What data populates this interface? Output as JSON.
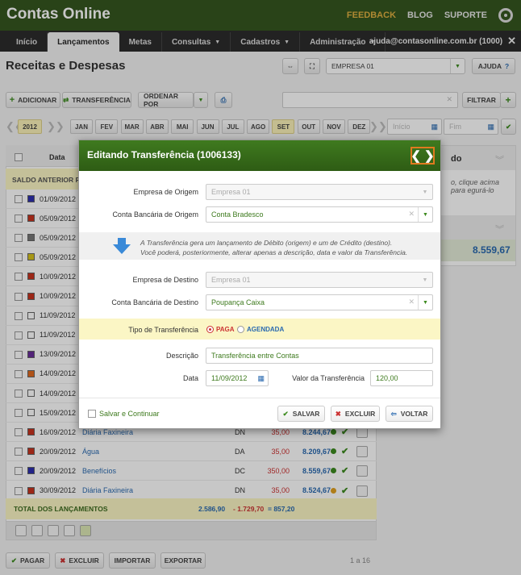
{
  "app": {
    "title": "Contas Online",
    "links": {
      "feedback": "FEEDBACK",
      "blog": "BLOG",
      "suporte": "SUPORTE"
    }
  },
  "nav": {
    "tabs": [
      "Início",
      "Lançamentos",
      "Metas",
      "Consultas",
      "Cadastros",
      "Administração"
    ],
    "user": "ajuda@contasonline.com.br (1000)"
  },
  "page": {
    "title": "Receitas e Despesas",
    "empresa": "EMPRESA 01",
    "ajuda": "AJUDA"
  },
  "toolbar": {
    "adicionar": "ADICIONAR",
    "transferencia": "TRANSFERÊNCIA",
    "ordenar": "ORDENAR POR",
    "filtrar": "FILTRAR"
  },
  "months": {
    "year": "2012",
    "list": [
      "JAN",
      "FEV",
      "MAR",
      "ABR",
      "MAI",
      "JUN",
      "JUL",
      "AGO",
      "SET",
      "OUT",
      "NOV",
      "DEZ"
    ],
    "active": "SET",
    "inicio": "Início",
    "fim": "Fim"
  },
  "table": {
    "col_data": "Data",
    "saldo_anterior": "SALDO ANTERIOR REA",
    "total_label": "TOTAL DOS LANÇAMENTOS",
    "total_in": "2.586,90",
    "total_out": "- 1.729,70",
    "total_eq": "= 857,20",
    "rows": [
      {
        "date": "01/09/2012",
        "color": "#2d2fb0"
      },
      {
        "date": "05/09/2012",
        "color": "#c8321e"
      },
      {
        "date": "05/09/2012",
        "color": "#777777"
      },
      {
        "date": "05/09/2012",
        "color": "#d7c21c"
      },
      {
        "date": "10/09/2012",
        "color": "#c8321e"
      },
      {
        "date": "10/09/2012",
        "color": "#c8321e"
      },
      {
        "date": "11/09/2012",
        "color": "#ffffff"
      },
      {
        "date": "11/09/2012",
        "color": "#ffffff"
      },
      {
        "date": "13/09/2012",
        "color": "#6a2d9a"
      },
      {
        "date": "14/09/2012",
        "color": "#e06a1f"
      },
      {
        "date": "14/09/2012",
        "color": "#ffffff"
      },
      {
        "date": "15/09/2012",
        "color": "#ffffff"
      },
      {
        "date": "16/09/2012",
        "color": "#c8321e",
        "desc": "Diária Faxineira",
        "type": "DN",
        "value": "35,00",
        "balance": "8.244,67"
      },
      {
        "date": "20/09/2012",
        "color": "#c8321e",
        "desc": "Água",
        "type": "DA",
        "value": "35,00",
        "balance": "8.209,67"
      },
      {
        "date": "20/09/2012",
        "color": "#2d2fb0",
        "desc": "Benefícios",
        "type": "DC",
        "value": "350,00",
        "balance": "8.559,67"
      },
      {
        "date": "30/09/2012",
        "color": "#c8321e",
        "desc": "Diária Faxineira",
        "type": "DN",
        "value": "35,00",
        "balance": "8.524,67"
      }
    ]
  },
  "side": {
    "title": "do",
    "hint": "o, clique acima para egurá-lo",
    "saldo": "8.559,67"
  },
  "bottom": {
    "pagar": "PAGAR",
    "excluir": "EXCLUIR",
    "importar": "IMPORTAR",
    "exportar": "EXPORTAR",
    "pages": "1 a 16"
  },
  "modal": {
    "title": "Editando Transferência (1006133)",
    "empresa_origem_label": "Empresa de Origem",
    "empresa_origem": "Empresa 01",
    "conta_origem_label": "Conta Bancária de Origem",
    "conta_origem": "Conta Bradesco",
    "note1": "A Transferência gera um lançamento de Débito (origem) e um de Crédito (destino).",
    "note2": "Você poderá, posteriormente, alterar apenas a descrição, data e valor da Transferência.",
    "empresa_destino_label": "Empresa de Destino",
    "empresa_destino": "Empresa 01",
    "conta_destino_label": "Conta Bancária de Destino",
    "conta_destino": "Poupança Caixa",
    "tipo_label": "Tipo de Transferência",
    "paga": "PAGA",
    "agendada": "AGENDADA",
    "descricao_label": "Descrição",
    "descricao": "Transferência entre Contas",
    "data_label": "Data",
    "data": "11/09/2012",
    "valor_label": "Valor da Transferência",
    "valor": "120,00",
    "salvar_continuar": "Salvar e Continuar",
    "salvar": "SALVAR",
    "excluir": "EXCLUIR",
    "voltar": "VOLTAR"
  }
}
